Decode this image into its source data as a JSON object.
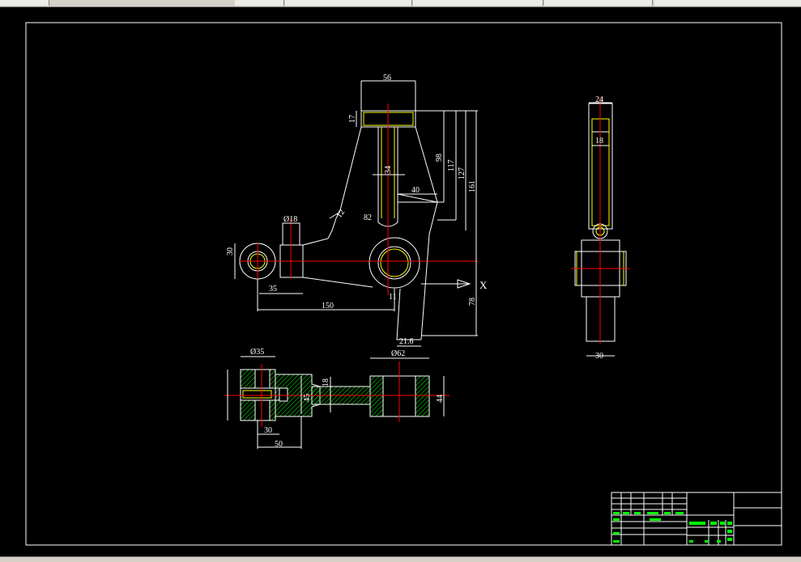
{
  "colors": {
    "background": "#000000",
    "outline": "#ffffff",
    "centerline": "#ff0000",
    "hidden_edge": "#ffff00",
    "hatch": "#00ff00",
    "title_block_text": "#00ff00"
  },
  "front_view": {
    "dims": {
      "top_width": "56",
      "top_height": "17",
      "slot_width": "34",
      "slot_depth": "40",
      "angle": "82",
      "h98": "98",
      "h117": "117",
      "h127": "127",
      "h161": "161",
      "boss_dia": "Ø18",
      "boss_height": "30",
      "boss_offset": "35",
      "arm_length": "150",
      "bottom_width": "21.6",
      "small_gap": "11",
      "lower_height": "78",
      "rib": "12"
    },
    "axis_label": "X"
  },
  "side_view": {
    "dims": {
      "top_width": "24",
      "inner_width": "18",
      "bottom_width": "30"
    }
  },
  "section_view": {
    "dims": {
      "left_dia": "Ø35",
      "right_dia": "Ø62",
      "neck": "18",
      "web": "45",
      "right_height": "44",
      "width30": "30",
      "width50": "50"
    }
  }
}
